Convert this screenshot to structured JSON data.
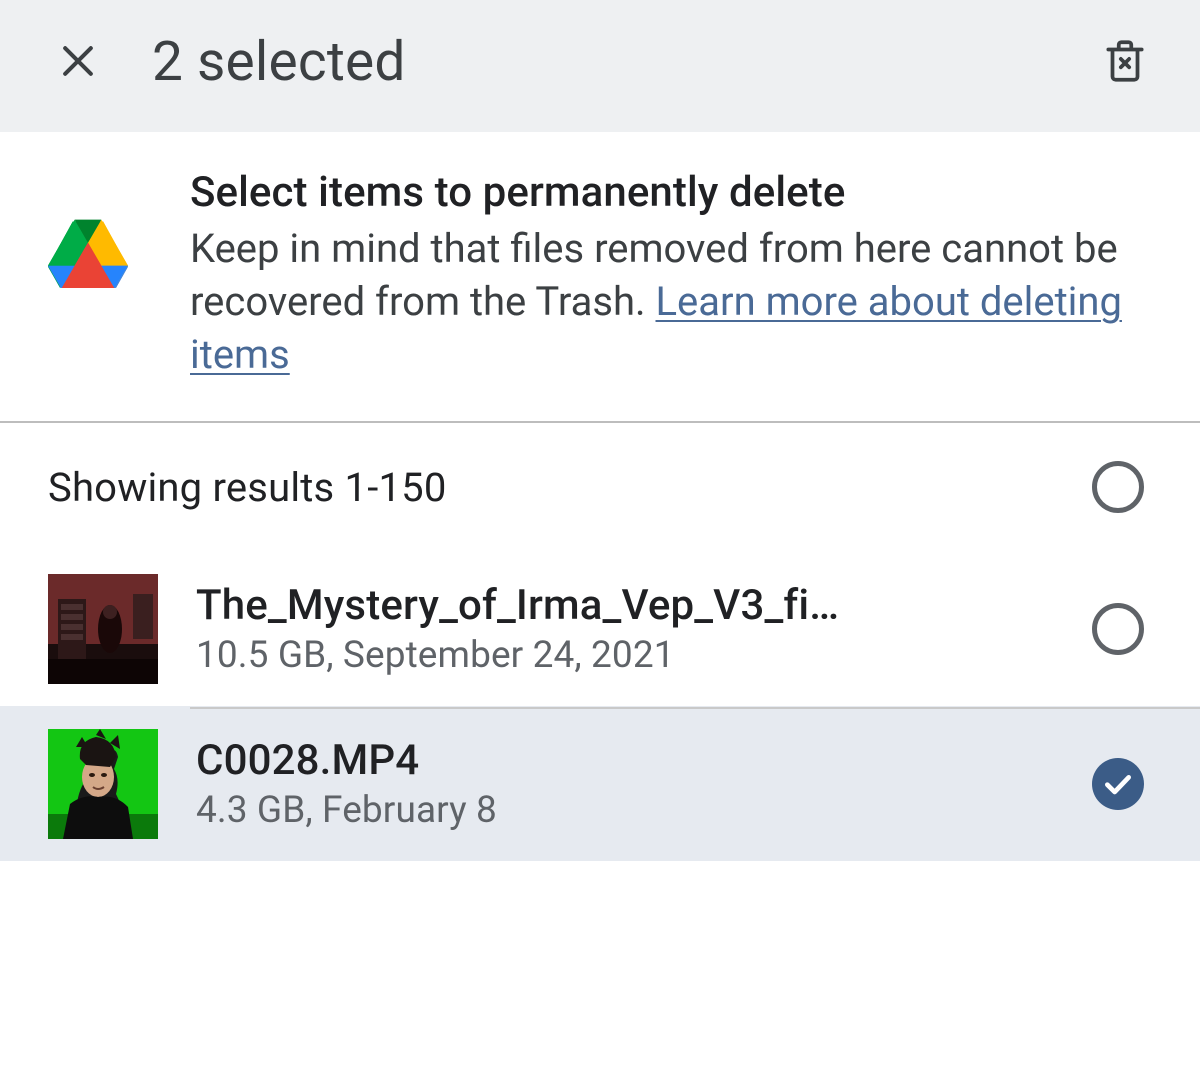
{
  "header": {
    "title": "2 selected"
  },
  "notice": {
    "title": "Select items to permanently delete",
    "body_prefix": "Keep in mind that files removed from here cannot be recovered from the Trash. ",
    "link_text": "Learn more about deleting items"
  },
  "results": {
    "label": "Showing results 1-150",
    "select_all_checked": false
  },
  "files": [
    {
      "name": "The_Mystery_of_Irma_Vep_V3_fi…",
      "meta": "10.5 GB, September 24, 2021",
      "selected": false
    },
    {
      "name": "C0028.MP4",
      "meta": "4.3 GB, February 8",
      "selected": true
    }
  ]
}
